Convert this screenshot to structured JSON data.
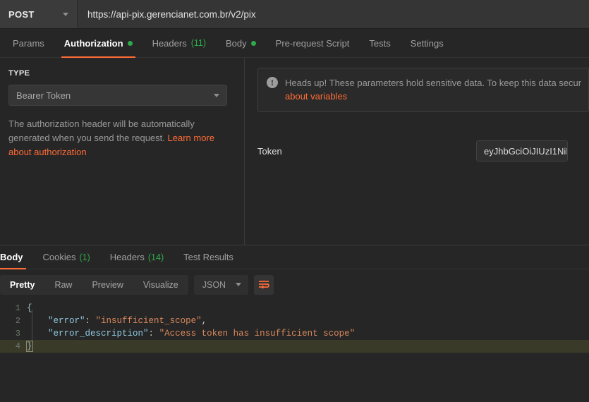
{
  "request": {
    "method": "POST",
    "url": "https://api-pix.gerencianet.com.br/v2/pix",
    "tabs": [
      {
        "label": "Params",
        "dot": false,
        "count": ""
      },
      {
        "label": "Authorization",
        "dot": true,
        "count": ""
      },
      {
        "label": "Headers",
        "dot": false,
        "count": "(11)"
      },
      {
        "label": "Body",
        "dot": true,
        "count": ""
      },
      {
        "label": "Pre-request Script",
        "dot": false,
        "count": ""
      },
      {
        "label": "Tests",
        "dot": false,
        "count": ""
      },
      {
        "label": "Settings",
        "dot": false,
        "count": ""
      }
    ],
    "active_tab": "Authorization"
  },
  "auth": {
    "type_label": "TYPE",
    "type_value": "Bearer Token",
    "helper_text": "The authorization header will be automatically generated when you send the request. ",
    "helper_link": "Learn more about authorization",
    "callout_line1": "Heads up! These parameters hold sensitive data. To keep this data secur",
    "callout_link": "about variables",
    "callout_icon": "exclamation-circle-icon",
    "token_label": "Token",
    "token_value": "eyJhbGciOiJIUzI1NiI"
  },
  "response": {
    "tabs": [
      {
        "label": "Body",
        "count": ""
      },
      {
        "label": "Cookies",
        "count": "(1)"
      },
      {
        "label": "Headers",
        "count": "(14)"
      },
      {
        "label": "Test Results",
        "count": ""
      }
    ],
    "active_tab": "Body",
    "view_modes": [
      "Pretty",
      "Raw",
      "Preview",
      "Visualize"
    ],
    "active_view": "Pretty",
    "format": "JSON",
    "wrap_icon": "word-wrap-icon",
    "body_lines": [
      {
        "n": "1",
        "brace": "{",
        "active": false
      },
      {
        "n": "2",
        "key": "\"error\"",
        "sep": ": ",
        "str": "\"insufficient_scope\"",
        "comma": ",",
        "active": false
      },
      {
        "n": "3",
        "key": "\"error_description\"",
        "sep": ": ",
        "str": "\"Access token has insufficient scope\"",
        "comma": "",
        "active": false
      },
      {
        "n": "4",
        "brace": "}",
        "active": true
      }
    ]
  },
  "colors": {
    "accent": "#ff6c37",
    "ok_green": "#2eaa4a",
    "json_key": "#8fc8de",
    "json_string": "#d8885c",
    "active_line": "#3a3a28",
    "background": "#262626"
  }
}
